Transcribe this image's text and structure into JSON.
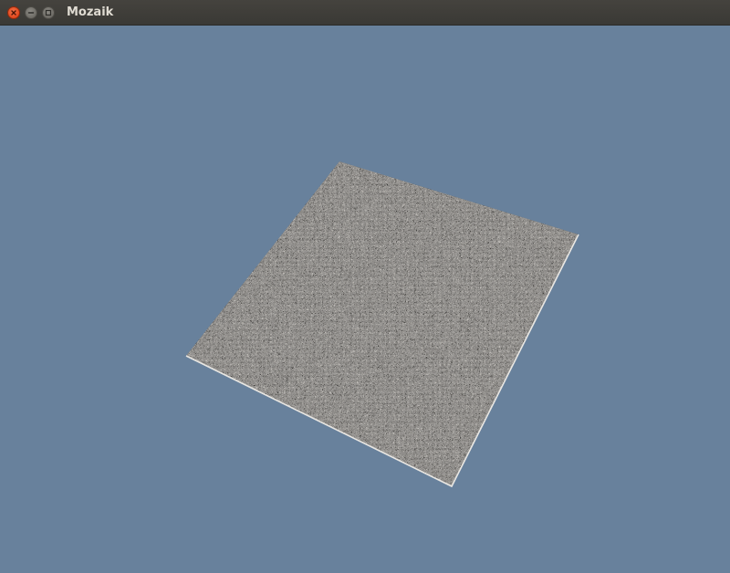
{
  "window": {
    "title": "Mozaik",
    "controls": {
      "close": "close-icon",
      "minimize": "minimize-icon",
      "maximize": "maximize-icon"
    }
  },
  "scene": {
    "background_color": "#68819c",
    "object": "textured-ground-plane",
    "texture": "gravel-stone",
    "texture_colors": {
      "dark": "#2b2a28",
      "mid": "#5b5854",
      "light": "#8d8a84"
    }
  }
}
